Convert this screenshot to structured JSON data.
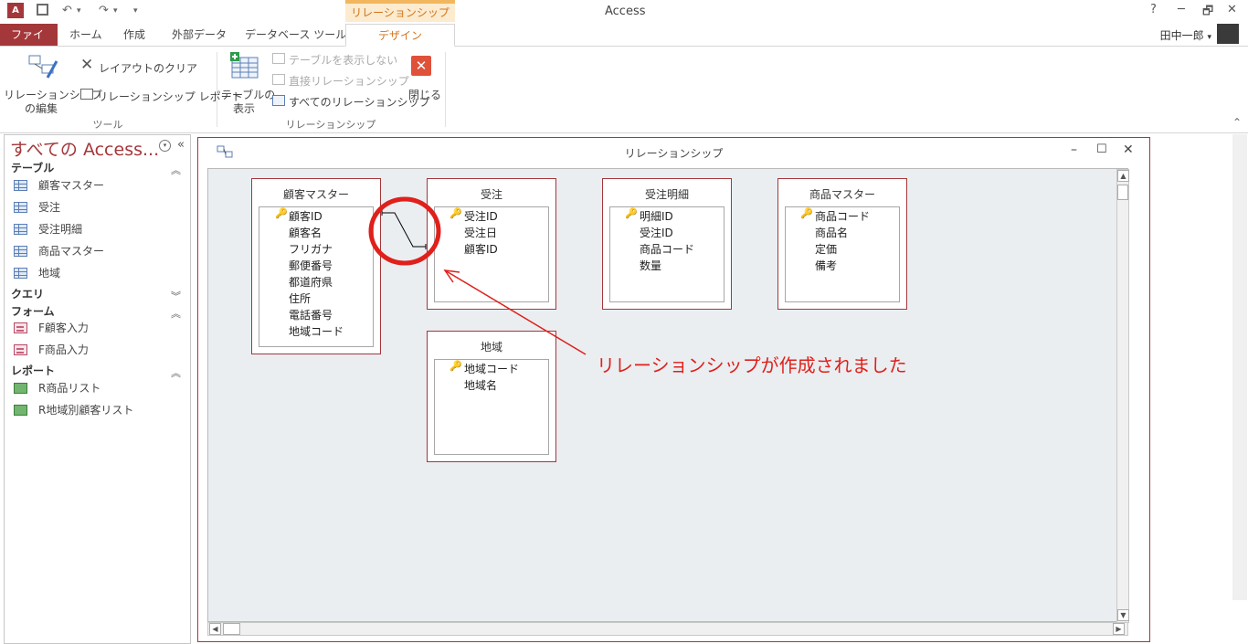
{
  "titlebar": {
    "app_title": "Access",
    "context_tab": "リレーションシップ ツール",
    "help": "?",
    "minimize": "─",
    "restore": "🗗",
    "close": "✕",
    "undo": "↶",
    "redo": "↷",
    "qat_more": "▾"
  },
  "tabs": [
    {
      "label": "ファイル"
    },
    {
      "label": "ホーム"
    },
    {
      "label": "作成"
    },
    {
      "label": "外部データ"
    },
    {
      "label": "データベース ツール"
    },
    {
      "label": "デザイン"
    }
  ],
  "user": {
    "name": "田中一郎",
    "dropdown": "▾"
  },
  "ribbon": {
    "tools_group": {
      "edit_relationships": [
        "リレーションシップ",
        "の編集"
      ],
      "clear_layout": "レイアウトのクリア",
      "relationship_report": "リレーションシップ レポート",
      "label": "ツール"
    },
    "relationships_group": {
      "show_table": [
        "テーブルの",
        "表示"
      ],
      "hide_table": "テーブルを表示しない",
      "direct_relationships": "直接リレーションシップ",
      "all_relationships": "すべてのリレーションシップ",
      "close": "閉じる",
      "label": "リレーションシップ"
    },
    "collapse": "⌃"
  },
  "nav": {
    "title": "すべての Access...",
    "collapse": "«",
    "sections": [
      {
        "label": "テーブル",
        "chev": "⌃⌃",
        "items": [
          "顧客マスター",
          "受注",
          "受注明細",
          "商品マスター",
          "地域"
        ]
      },
      {
        "label": "クエリ",
        "chev": "⌄⌄",
        "items": []
      },
      {
        "label": "フォーム",
        "chev": "⌃⌃",
        "items": [
          "F顧客入力",
          "F商品入力"
        ]
      },
      {
        "label": "レポート",
        "chev": "⌃⌃",
        "items": [
          "R商品リスト",
          "R地域別顧客リスト"
        ]
      }
    ]
  },
  "relwindow": {
    "title": "リレーションシップ",
    "minimize": "–",
    "maximize": "☐",
    "close": "✕"
  },
  "tables": [
    {
      "name": "顧客マスター",
      "fields": [
        "顧客ID",
        "顧客名",
        "フリガナ",
        "郵便番号",
        "都道府県",
        "住所",
        "電話番号",
        "地域コード"
      ],
      "key": 0
    },
    {
      "name": "受注",
      "fields": [
        "受注ID",
        "受注日",
        "顧客ID"
      ],
      "key": 0
    },
    {
      "name": "受注明細",
      "fields": [
        "明細ID",
        "受注ID",
        "商品コード",
        "数量"
      ],
      "key": 0
    },
    {
      "name": "商品マスター",
      "fields": [
        "商品コード",
        "商品名",
        "定価",
        "備考"
      ],
      "key": 0
    },
    {
      "name": "地域",
      "fields": [
        "地域コード",
        "地域名"
      ],
      "key": 0
    }
  ],
  "annotation": "リレーションシップが作成されました",
  "colors": {
    "accent": "#a4373a",
    "context": "#d2741a",
    "annotation": "#e0201b"
  }
}
